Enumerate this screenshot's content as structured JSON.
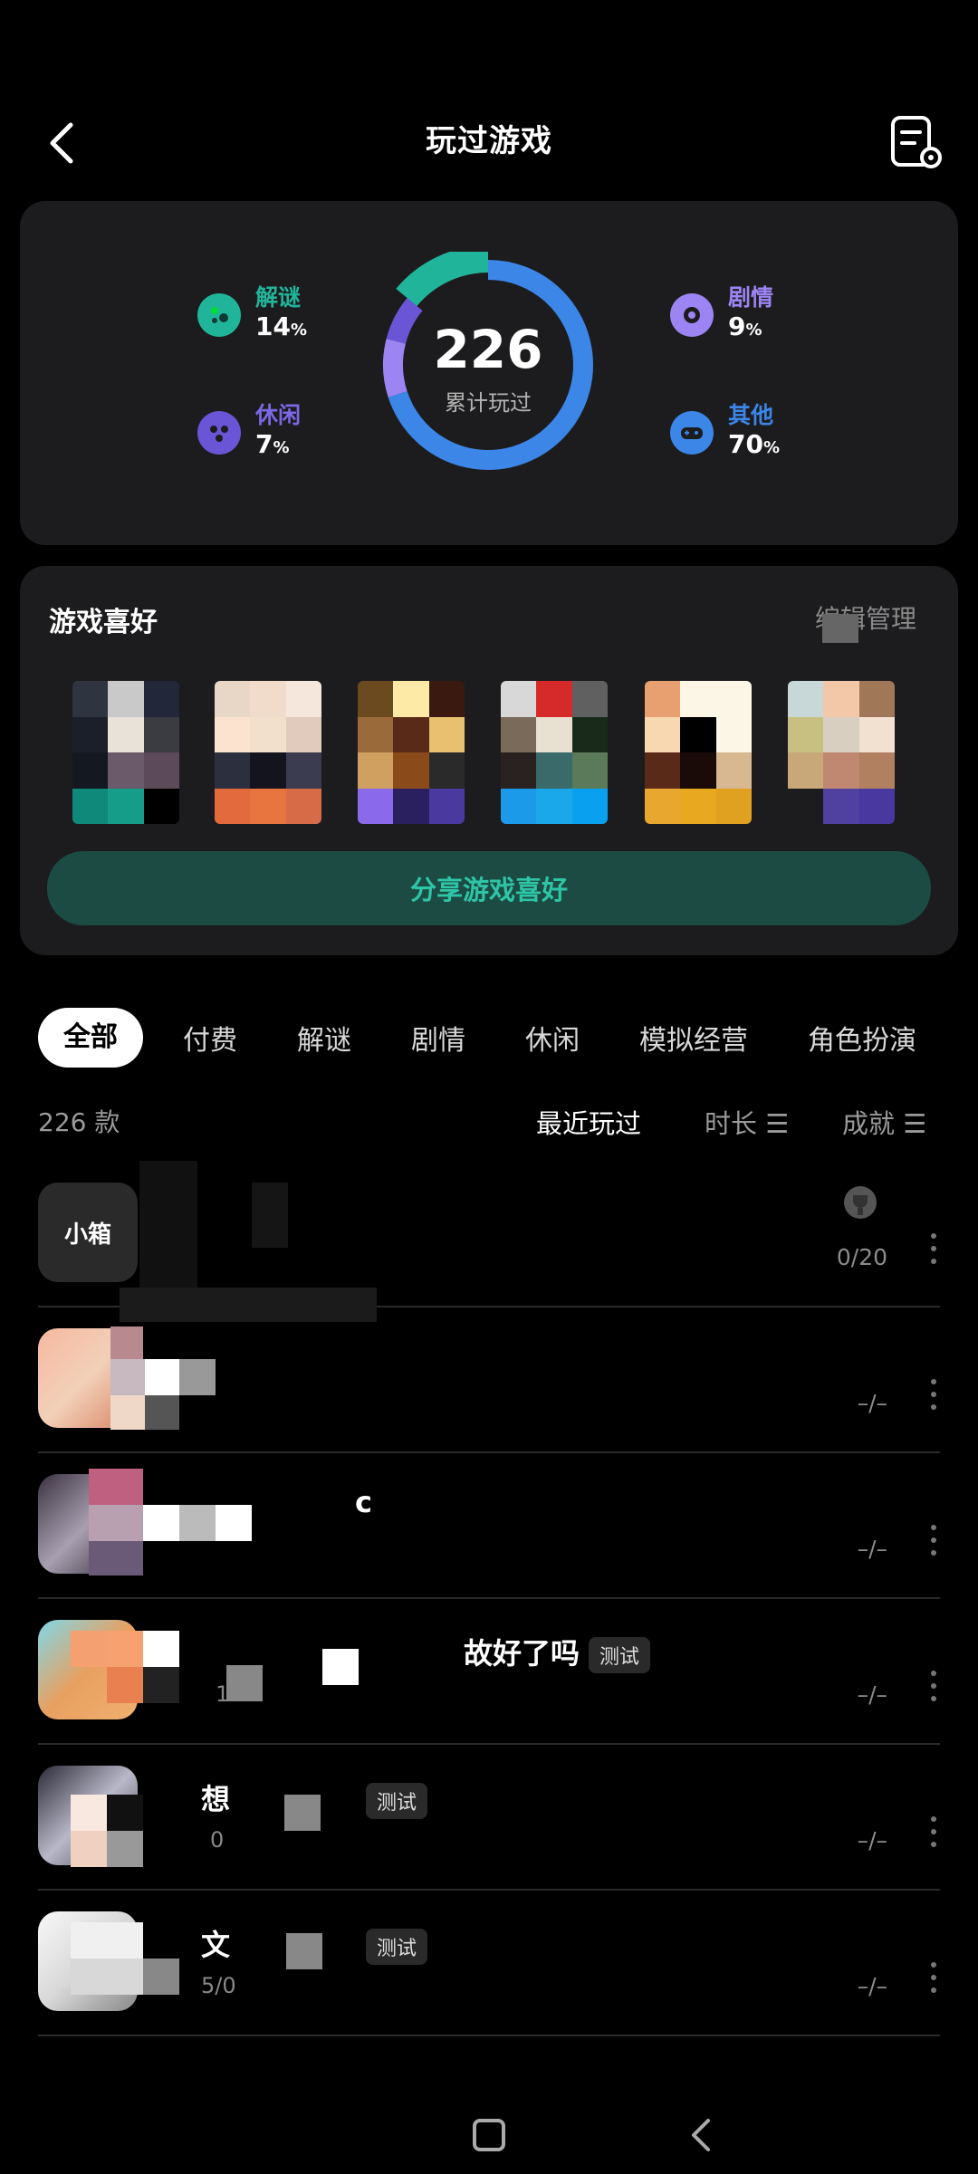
{
  "header": {
    "title": "玩过游戏"
  },
  "stats": {
    "total": "226",
    "total_label": "累计玩过",
    "genres": [
      {
        "name": "解谜",
        "pct": "14",
        "unit": "%",
        "color": "#20b59a"
      },
      {
        "name": "休闲",
        "pct": "7",
        "unit": "%",
        "color": "#6a55d6"
      },
      {
        "name": "剧情",
        "pct": "9",
        "unit": "%",
        "color": "#9c85f2"
      },
      {
        "name": "其他",
        "pct": "70",
        "unit": "%",
        "color": "#3c86e8"
      }
    ]
  },
  "preference": {
    "title": "游戏喜好",
    "edit_label": "编辑管理",
    "share_label": "分享游戏喜好"
  },
  "tabs": [
    "全部",
    "付费",
    "解谜",
    "剧情",
    "休闲",
    "模拟经营",
    "角色扮演"
  ],
  "list": {
    "count_label": "226 款",
    "sort": {
      "recent": "最近玩过",
      "duration": "时长",
      "achievement": "成就"
    },
    "games": [
      {
        "name": "",
        "sub": "",
        "tag": "",
        "progress": "0/20",
        "icon_text": "小箱"
      },
      {
        "name": "",
        "sub": "",
        "tag": "",
        "progress": "–/–",
        "icon_text": ""
      },
      {
        "name": "c",
        "sub": "",
        "tag": "",
        "progress": "–/–",
        "icon_text": ""
      },
      {
        "name": "故好了吗",
        "sub": "1",
        "tag": "测试",
        "progress": "–/–",
        "icon_text": ""
      },
      {
        "name": "想",
        "sub": "0",
        "tag": "测试",
        "progress": "–/–",
        "icon_text": ""
      },
      {
        "name": "文",
        "sub": "5/0",
        "tag": "测试",
        "progress": "–/–",
        "icon_text": ""
      }
    ]
  }
}
